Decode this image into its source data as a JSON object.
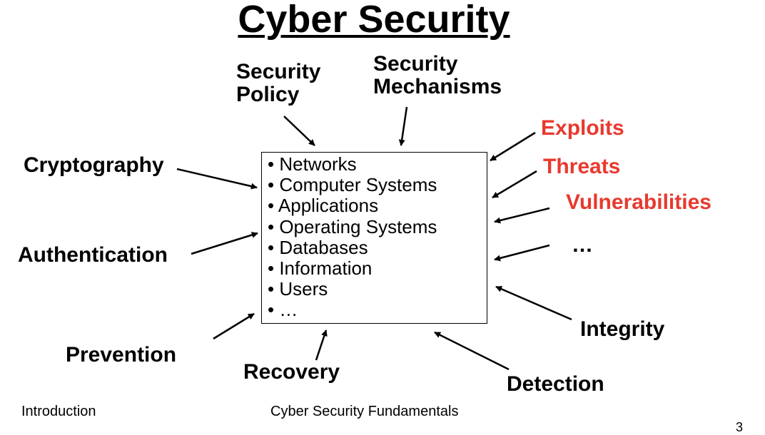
{
  "slide": {
    "title": "Cyber Security",
    "box_items": [
      "Networks",
      "Computer Systems",
      "Applications",
      "Operating Systems",
      "Databases",
      "Information",
      "Users",
      "…"
    ],
    "labels": {
      "security_policy_line1": "Security",
      "security_policy_line2": "Policy",
      "security_mechanisms_line1": "Security",
      "security_mechanisms_line2": "Mechanisms",
      "cryptography": "Cryptography",
      "authentication": "Authentication",
      "prevention": "Prevention",
      "recovery": "Recovery",
      "detection": "Detection",
      "integrity": "Integrity",
      "exploits": "Exploits",
      "threats": "Threats",
      "vulnerabilities": "Vulnerabilities",
      "ellipsis": "…"
    },
    "footer": {
      "left": "Introduction",
      "center": "Cyber Security Fundamentals",
      "page_number": "3"
    }
  },
  "colors": {
    "text": "#000000",
    "accent_red": "#e8392e",
    "background": "#ffffff"
  }
}
